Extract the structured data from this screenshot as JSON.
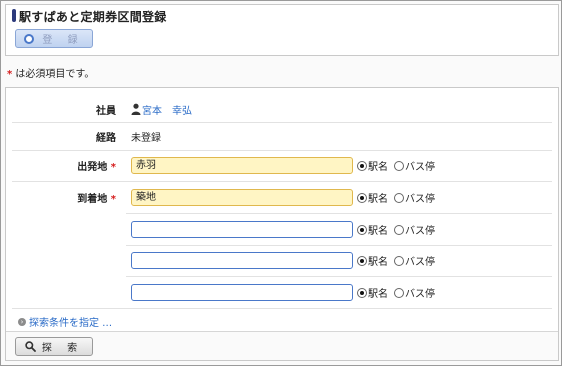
{
  "page": {
    "title": "駅すぱあと定期券区間登録",
    "register_button": "登 録",
    "required_note": "は必須項目です。",
    "required_mark": "*"
  },
  "form": {
    "employee_label": "社員",
    "employee_name": "宮本　幸弘",
    "route_label": "経路",
    "route_value": "未登録",
    "departure_label": "出発地",
    "departure_value": "赤羽",
    "arrival_label": "到着地",
    "arrival_value": "築地",
    "stops": [
      {
        "value": ""
      },
      {
        "value": ""
      },
      {
        "value": ""
      }
    ],
    "radio_station": "駅名",
    "radio_bus": "バス停",
    "advanced_link": "探索条件を指定 …",
    "search_button": "探 索"
  },
  "colors": {
    "accent": "#2a6bc7",
    "required": "#d51b1b",
    "highlight_field": "#fff5c4"
  }
}
